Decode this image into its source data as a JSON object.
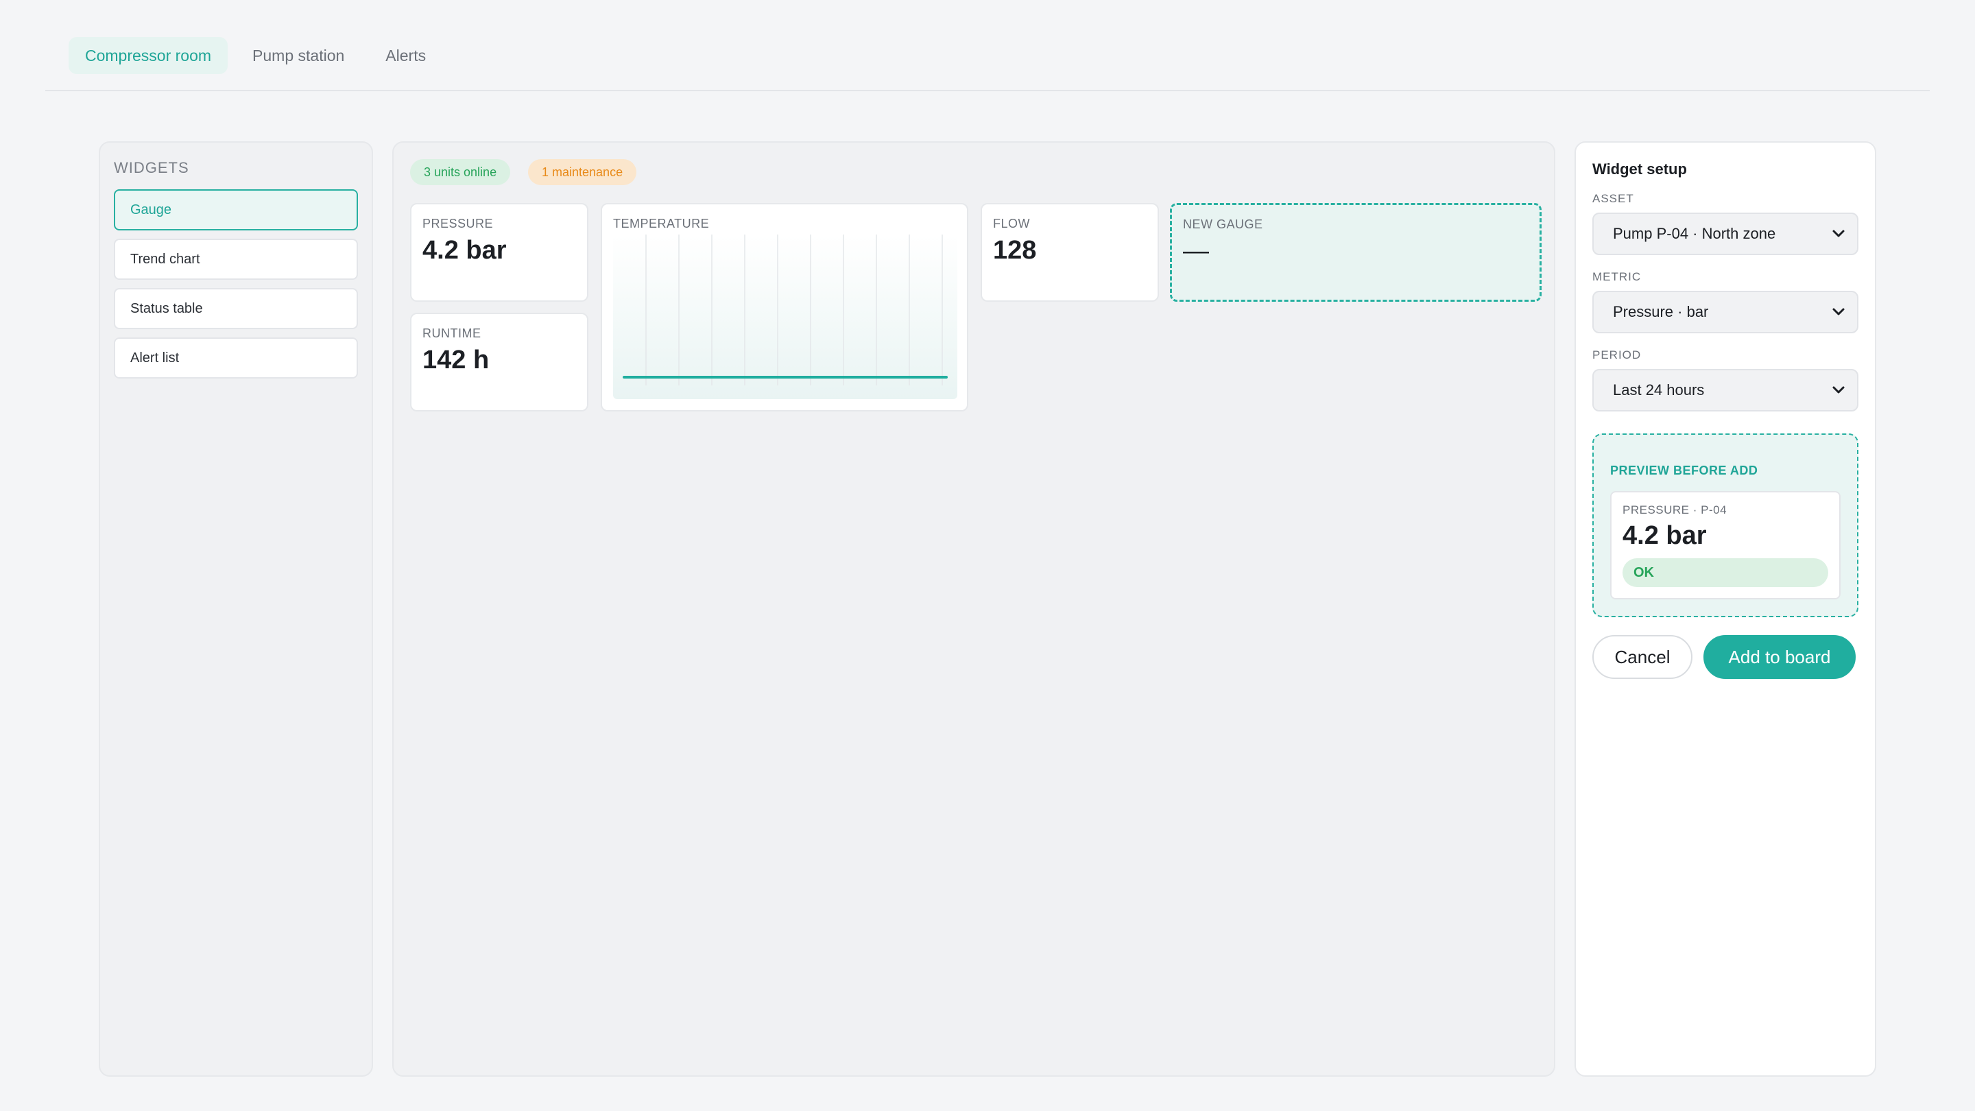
{
  "tabs": [
    "Compressor room",
    "Pump station",
    "Alerts"
  ],
  "widgets_panel": {
    "title": "WIDGETS",
    "items": [
      "Gauge",
      "Trend chart",
      "Status table",
      "Alert list"
    ],
    "selected": "Gauge"
  },
  "board": {
    "status_pills": {
      "online": "3 units online",
      "maintenance": "1 maintenance"
    },
    "cards": {
      "pressure": {
        "label": "PRESSURE",
        "value": "4.2 bar"
      },
      "runtime": {
        "label": "RUNTIME",
        "value": "142 h"
      },
      "temperature": {
        "label": "TEMPERATURE"
      },
      "flow": {
        "label": "FLOW",
        "value": "128"
      },
      "new_gauge": {
        "label": "NEW GAUGE",
        "value": "—"
      }
    }
  },
  "setup": {
    "title": "Widget setup",
    "asset": {
      "label": "ASSET",
      "value": "Pump P-04 · North zone"
    },
    "metric": {
      "label": "METRIC",
      "value": "Pressure · bar"
    },
    "period": {
      "label": "PERIOD",
      "value": "Last 24 hours"
    },
    "preview": {
      "title": "PREVIEW BEFORE ADD",
      "label": "PRESSURE · P-04",
      "value": "4.2 bar",
      "status": "OK"
    },
    "cancel_label": "Cancel",
    "add_label": "Add to board"
  },
  "colors": {
    "accent": "#20ae9f",
    "ok_green": "#27a45a",
    "warning_orange": "#e88a19"
  }
}
